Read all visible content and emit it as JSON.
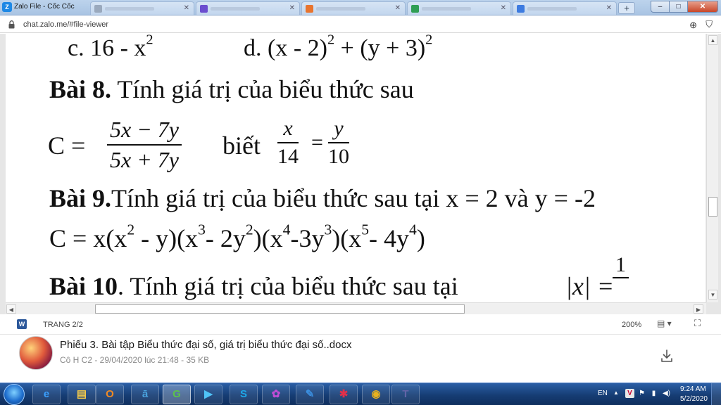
{
  "window": {
    "title": "Zalo File - Cốc Cốc",
    "tabs": [
      {
        "favicon_color": "#9aa9bd"
      },
      {
        "favicon_color": "#6b4dcf"
      },
      {
        "favicon_color": "#e8742e"
      },
      {
        "favicon_color": "#2f9e54"
      },
      {
        "favicon_color": "#3d7be0"
      }
    ],
    "new_tab_label": "+",
    "minimize": "–",
    "maximize": "□",
    "close": "✕"
  },
  "address_bar": {
    "url": "chat.zalo.me/#file-viewer"
  },
  "document": {
    "line1_c": "c. 16 - x",
    "line1_c_sup": "2",
    "line1_d_pre": "d. (x - 2)",
    "line1_d_sup1": "2",
    "line1_d_mid": " + (y + 3)",
    "line1_d_sup2": "2",
    "bai8_label": "Bài 8.",
    "bai8_text": " Tính giá trị của biểu thức sau",
    "c_eq": "C =",
    "frac1_num": "5x − 7y",
    "frac1_den": "5x + 7y",
    "biet": "biết",
    "frac2_num": "x",
    "frac2_den": "14",
    "eq_sign": "=",
    "frac3_num": "y",
    "frac3_den": "10",
    "bai9_label": "Bài 9.",
    "bai9_text": "Tính giá trị của biểu thức sau tại x = 2 và y = -2",
    "expr_parts": [
      "C = x(x",
      "2",
      " - y)(x",
      "3",
      "- 2y",
      "2",
      ")(x",
      "4",
      "-3y",
      "3",
      ")(x",
      "5",
      "- 4y",
      "4",
      ")"
    ],
    "bai10_label": "Bài 10",
    "bai10_text": ". Tính giá trị của biểu thức sau tại",
    "abs_expr": "|x| =",
    "abs_num": "1"
  },
  "viewer_status": {
    "page_indicator": "TRANG 2/2",
    "zoom": "200%"
  },
  "file_info": {
    "name": "Phiếu 3. Bài tập Biểu thức đại số, giá trị biểu thức đại số..docx",
    "meta": "Cô H C2 - 29/04/2020 lúc 21:48 - 35 KB"
  },
  "taskbar": {
    "apps": [
      {
        "name": "ie",
        "glyph": "e",
        "color": "#3aa0ff"
      },
      {
        "name": "explorer",
        "glyph": "▤",
        "color": "#f3c94a"
      },
      {
        "name": "outlook",
        "glyph": "O",
        "color": "#f08a24"
      },
      {
        "name": "notes",
        "glyph": "ā",
        "color": "#4aa3df"
      },
      {
        "name": "coccoc",
        "glyph": "G",
        "color": "#5cc24a"
      },
      {
        "name": "media",
        "glyph": "▶",
        "color": "#4fc3f7"
      },
      {
        "name": "skype",
        "glyph": "S",
        "color": "#1ea7e8"
      },
      {
        "name": "flower",
        "glyph": "✿",
        "color": "#c04dd6"
      },
      {
        "name": "pen",
        "glyph": "✎",
        "color": "#3b8fe0"
      },
      {
        "name": "huawei",
        "glyph": "✱",
        "color": "#e0304a"
      },
      {
        "name": "chrome",
        "glyph": "◉",
        "color": "#e8b21e"
      },
      {
        "name": "teams",
        "glyph": "T",
        "color": "#6264a7"
      }
    ],
    "lang": "EN",
    "time": "9:24 AM",
    "date": "5/2/2020"
  }
}
